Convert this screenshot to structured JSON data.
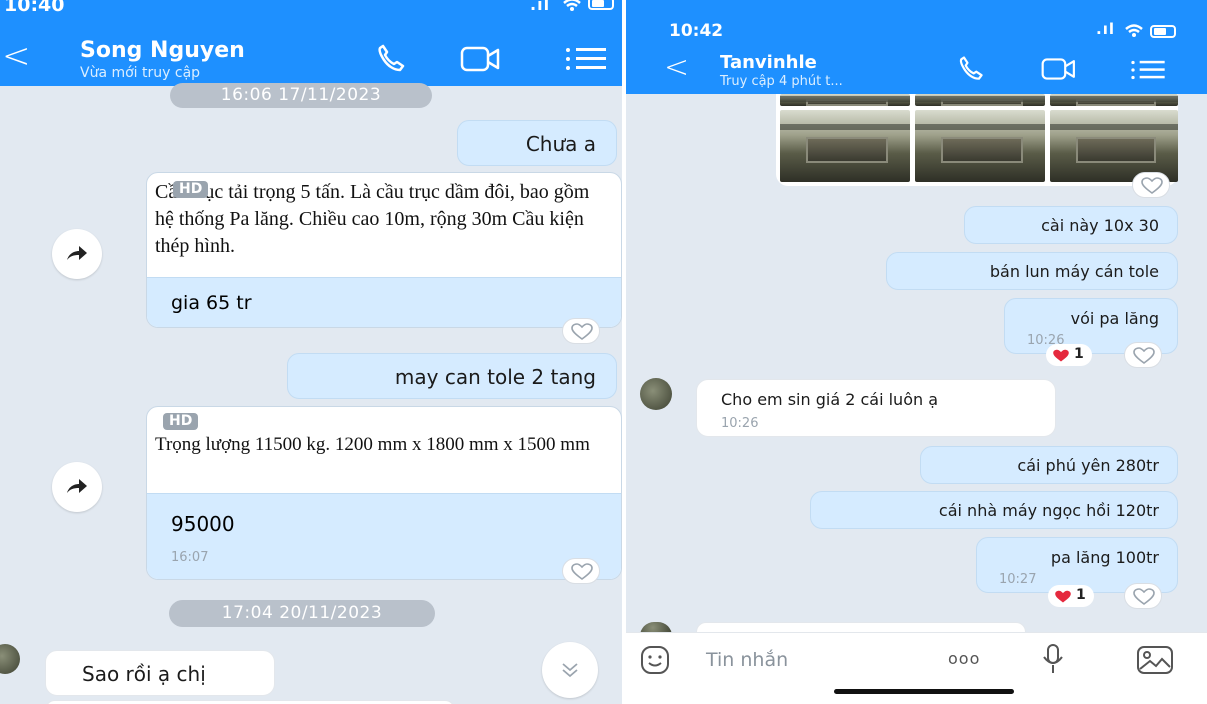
{
  "left": {
    "status": {
      "time": "10:40",
      "signal": ".ıl"
    },
    "header": {
      "back": "<",
      "name": "Song Nguyen",
      "subtitle": "Vừa mới truy cập"
    },
    "messages": {
      "date1": "16:06 17/11/2023",
      "m1": "Chưa a",
      "card1_badge": "HD",
      "card1_text": "Cầu trục tải trọng 5 tấn. Là cầu trục dầm đôi, bao gồm hệ thống Pa lăng. Chiều cao 10m, rộng 30m Cầu kiện thép hình.",
      "card1_reply": "gia 65 tr",
      "m2": "may can tole 2 tang",
      "card2_badge": "HD",
      "card2_text": "Trọng lượng 11500 kg. 1200 mm x 1800 mm x 1500 mm",
      "card2_reply": "95000",
      "card2_time": "16:07",
      "date2": "17:04 20/11/2023",
      "m3": "Sao rồi ạ chị"
    }
  },
  "right": {
    "status": {
      "time": "10:42",
      "signal": ".ıl"
    },
    "header": {
      "back": "<",
      "name": "Tanvinhle",
      "subtitle": "Truy cập 4 phút t..."
    },
    "messages": {
      "m1": "cài này 10x 30",
      "m2": "bán lun máy cán tole",
      "m3": "vói pa lăng",
      "m3_time": "10:26",
      "m3_hearts": "1",
      "in1": "Cho em sin giá 2 cái luôn ạ",
      "in1_time": "10:26",
      "m4": "cái phú yên 280tr",
      "m5": "cái nhà máy ngọc hồi 120tr",
      "m6": "pa lăng 100tr",
      "m6_time": "10:27",
      "m6_hearts": "1"
    },
    "compose": {
      "placeholder": "Tin nhắn",
      "more": "ooo"
    }
  },
  "icons": {
    "phone": "phone-icon",
    "video": "video-icon",
    "menu": "menu-icon",
    "forward": "forward-icon",
    "heart": "heart-icon",
    "chevron": "chevron-down-icon",
    "sticker": "sticker-icon",
    "mic": "mic-icon",
    "image": "image-icon"
  },
  "colors": {
    "header": "#1e90ff",
    "outgoing": "#d5ebff",
    "incoming": "#ffffff",
    "background": "#e2e9f1",
    "heart": "#e5293e"
  }
}
